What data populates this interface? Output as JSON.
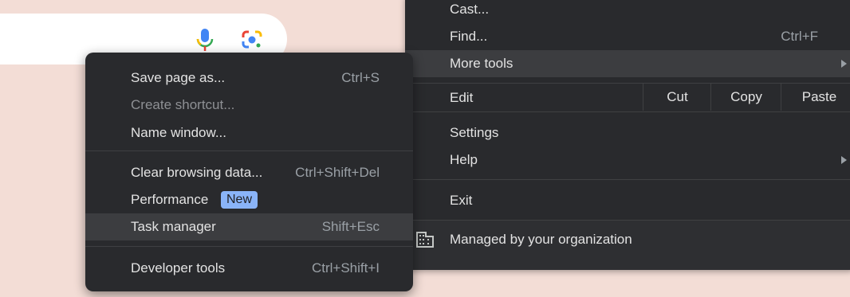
{
  "main_menu": {
    "cast": "Cast...",
    "find": {
      "label": "Find...",
      "shortcut": "Ctrl+F"
    },
    "more_tools": "More tools",
    "edit": {
      "label": "Edit",
      "cut": "Cut",
      "copy": "Copy",
      "paste": "Paste"
    },
    "settings": "Settings",
    "help": "Help",
    "exit": "Exit",
    "managed": "Managed by your organization"
  },
  "submenu": {
    "save_page": {
      "label": "Save page as...",
      "shortcut": "Ctrl+S"
    },
    "create_shortcut": "Create shortcut...",
    "name_window": "Name window...",
    "clear_browsing": {
      "label": "Clear browsing data...",
      "shortcut": "Ctrl+Shift+Del"
    },
    "performance": {
      "label": "Performance",
      "badge": "New"
    },
    "task_manager": {
      "label": "Task manager",
      "shortcut": "Shift+Esc"
    },
    "developer_tools": {
      "label": "Developer tools",
      "shortcut": "Ctrl+Shift+I"
    }
  },
  "icons": {
    "mic": "microphone-icon",
    "lens": "google-lens-icon",
    "building": "building-icon"
  },
  "colors": {
    "menu_bg": "#292a2d",
    "highlight": "#3c3d40",
    "badge": "#8ab4f8",
    "page_bg": "#f3ddd6"
  }
}
